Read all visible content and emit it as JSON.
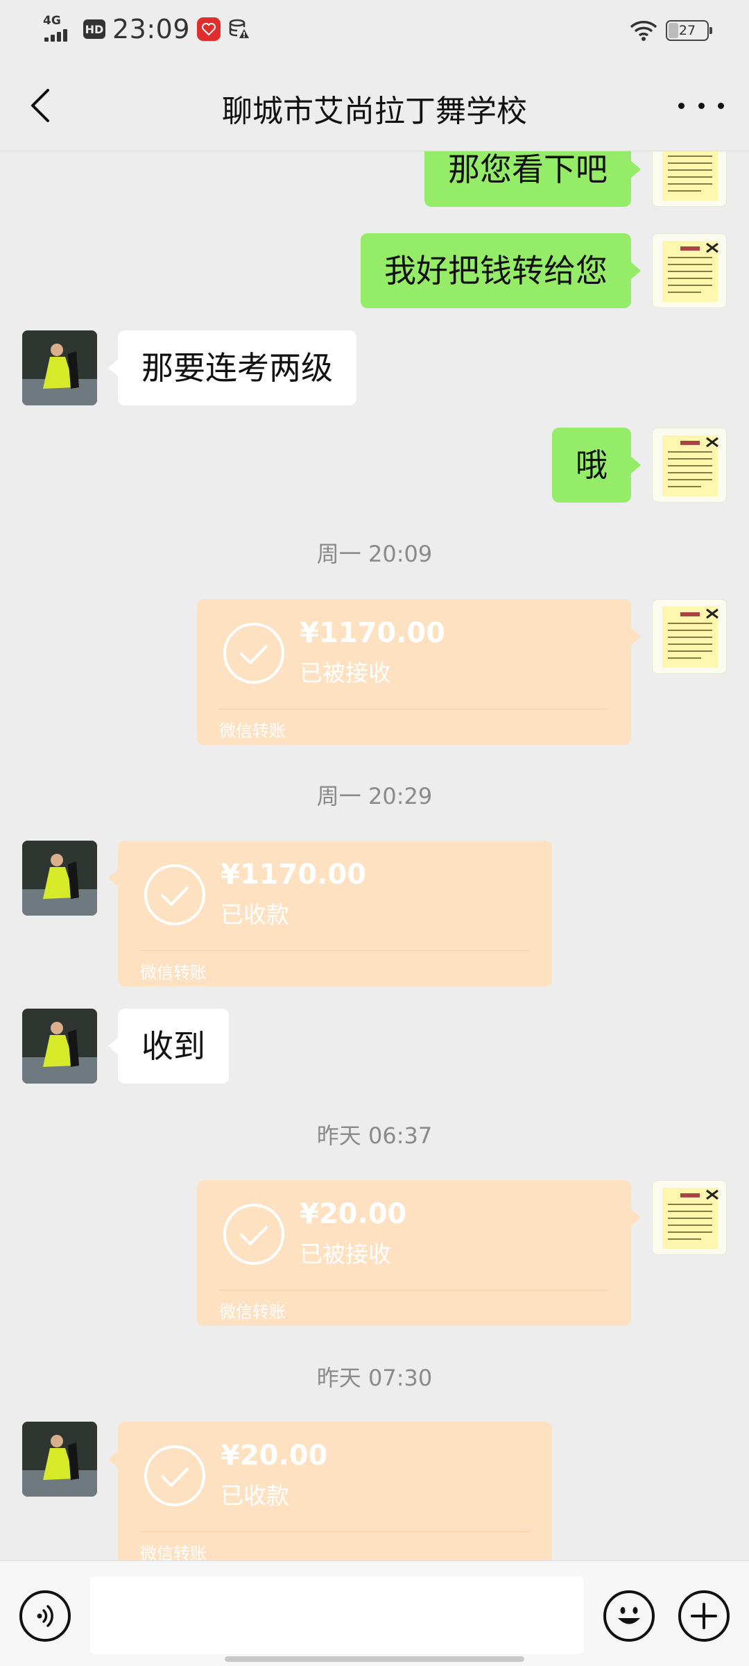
{
  "status_bar": {
    "network": "4G",
    "hd": "HD",
    "time": "23:09",
    "battery": "27"
  },
  "header": {
    "title": "聊城市艾尚拉丁舞学校"
  },
  "messages": [
    {
      "type": "text",
      "side": "me",
      "text": "那您看下吧"
    },
    {
      "type": "text",
      "side": "me",
      "text": "我好把钱转给您"
    },
    {
      "type": "text",
      "side": "them",
      "text": "那要连考两级"
    },
    {
      "type": "text",
      "side": "me",
      "text": "哦"
    },
    {
      "type": "time",
      "text": "周一 20:09"
    },
    {
      "type": "transfer",
      "side": "me",
      "amount": "¥1170.00",
      "status": "已被接收",
      "label": "微信转账"
    },
    {
      "type": "time",
      "text": "周一 20:29"
    },
    {
      "type": "transfer",
      "side": "them",
      "amount": "¥1170.00",
      "status": "已收款",
      "label": "微信转账"
    },
    {
      "type": "text",
      "side": "them",
      "text": "收到"
    },
    {
      "type": "time",
      "text": "昨天 06:37"
    },
    {
      "type": "transfer",
      "side": "me",
      "amount": "¥20.00",
      "status": "已被接收",
      "label": "微信转账"
    },
    {
      "type": "time",
      "text": "昨天 07:30"
    },
    {
      "type": "transfer",
      "side": "them",
      "amount": "¥20.00",
      "status": "已收款",
      "label": "微信转账"
    }
  ],
  "input_bar": {
    "placeholder": "",
    "value": ""
  },
  "colors": {
    "background": "#ededed",
    "my_bubble": "#95ec69",
    "their_bubble": "#ffffff",
    "transfer_card": "#fde1c1"
  },
  "icons": [
    "back-arrow-icon",
    "more-icon",
    "voice-icon",
    "emoji-icon",
    "plus-icon",
    "checkmark-icon",
    "wifi-icon",
    "battery-icon"
  ]
}
